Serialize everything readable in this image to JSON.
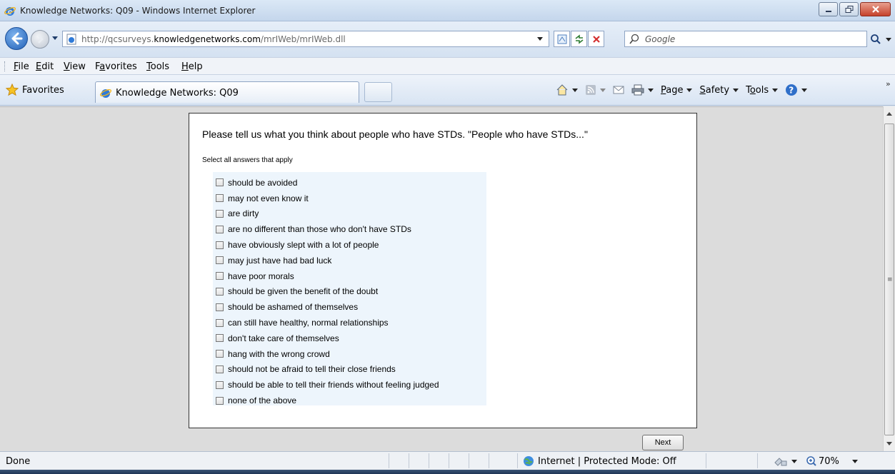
{
  "window": {
    "title": "Knowledge Networks: Q09 - Windows Internet Explorer"
  },
  "address_bar": {
    "url_prefix": "http://qcsurveys.",
    "url_domain": "knowledgenetworks.com",
    "url_path": "/mrIWeb/mrIWeb.dll",
    "search_placeholder": "Google"
  },
  "menu": {
    "items": [
      {
        "pre": "",
        "key": "F",
        "post": "ile"
      },
      {
        "pre": "",
        "key": "E",
        "post": "dit"
      },
      {
        "pre": "",
        "key": "V",
        "post": "iew"
      },
      {
        "pre": "F",
        "key": "a",
        "post": "vorites"
      },
      {
        "pre": "",
        "key": "T",
        "post": "ools"
      },
      {
        "pre": "",
        "key": "H",
        "post": "elp"
      }
    ]
  },
  "command_bar": {
    "favorites_label": "Favorites",
    "tab_label": "Knowledge Networks: Q09",
    "page": {
      "key": "P",
      "post": "age"
    },
    "safety": {
      "key": "S",
      "post": "afety"
    },
    "tools": {
      "pre": "T",
      "key": "o",
      "post": "ols"
    },
    "overflow": "»"
  },
  "survey": {
    "question": "Please tell us what you think about people who have STDs. \"People who have STDs...\"",
    "instruction": "Select all answers that apply",
    "options": [
      "should be avoided",
      "may not even know it",
      "are dirty",
      "are no different than those who don't have STDs",
      "have obviously slept with a lot of people",
      "may just have had bad luck",
      "have poor morals",
      "should be given the benefit of the doubt",
      "should be ashamed of themselves",
      "can still have healthy, normal relationships",
      "don't take care of themselves",
      "hang with the wrong crowd",
      "should not be afraid to tell their close friends",
      "should be able to tell their friends without feeling judged",
      "none of the above"
    ],
    "next_label": "Next"
  },
  "status_bar": {
    "status": "Done",
    "zone": "Internet | Protected Mode: Off",
    "zoom": "70%"
  },
  "colors": {
    "options_background": "#edf5fc",
    "page_background": "#dcdcdc"
  }
}
